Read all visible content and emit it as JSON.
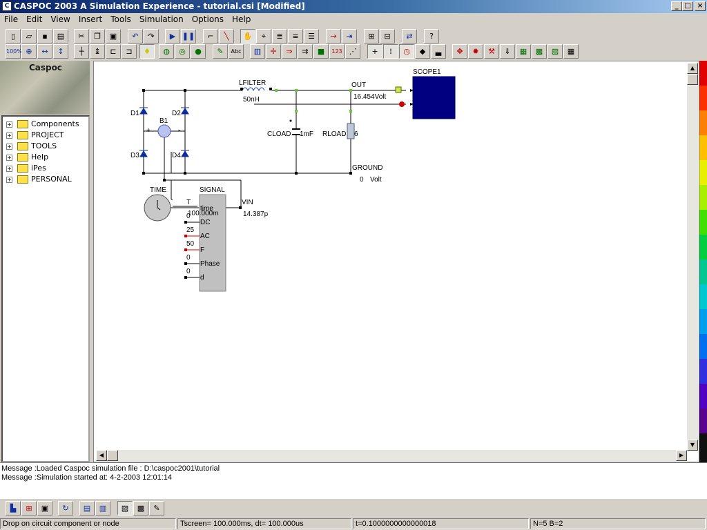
{
  "window": {
    "title": "CASPOC 2003 A Simulation Experience - tutorial.csi [Modified]",
    "minimize": "_",
    "maximize": "□",
    "close": "×"
  },
  "menu": [
    "File",
    "Edit",
    "View",
    "Insert",
    "Tools",
    "Simulation",
    "Options",
    "Help"
  ],
  "toolbar": {
    "zoom_label": "100%"
  },
  "sidebar": {
    "banner": "Caspoc",
    "tree": [
      {
        "label": "Components"
      },
      {
        "label": "PROJECT"
      },
      {
        "label": "TOOLS"
      },
      {
        "label": "Help"
      },
      {
        "label": "iPes"
      },
      {
        "label": "PERSONAL"
      }
    ]
  },
  "circuit": {
    "lfilter_label": "LFILTER",
    "lfilter_value": "50nH",
    "out_label": "OUT",
    "out_value": "16.454Volt",
    "scope_label": "SCOPE1",
    "d1": "D1",
    "d2": "D2",
    "d3": "D3",
    "d4": "D4",
    "b1": "B1",
    "plus": "+",
    "minus": "-",
    "cload_label": "CLOAD",
    "cload_value": "1mF",
    "rload_label": "RLOAD",
    "rload_value": "6",
    "ground_label": "GROUND",
    "ground_value": "0",
    "ground_unit": "Volt",
    "time_label": "TIME",
    "signal_label": "SIGNAL",
    "t_label": "T",
    "vin_label": "VIN",
    "vin_value": "14.387p",
    "signal_ports": [
      {
        "value": "100.000m",
        "name": "time"
      },
      {
        "value": "0",
        "name": "DC"
      },
      {
        "value": "25",
        "name": "AC"
      },
      {
        "value": "50",
        "name": "F"
      },
      {
        "value": "0",
        "name": "Phase"
      },
      {
        "value": "0",
        "name": "d"
      }
    ]
  },
  "messages": [
    "Message :Loaded Caspoc simulation file : D:\\caspoc2001\\tutorial",
    "Message :Simulation started at: 4-2-2003 12:01:14"
  ],
  "status": {
    "hint": "Drop on circuit component or node",
    "tscreen": "Tscreen= 100.000ms, dt= 100.000us",
    "t": "t=0.1000000000000018",
    "nb": "N=5 B=2"
  },
  "colors": {
    "title_start": "#0a246a",
    "scope_fill": "#000080",
    "wire": "#000000",
    "node_green": "#66cc33"
  }
}
